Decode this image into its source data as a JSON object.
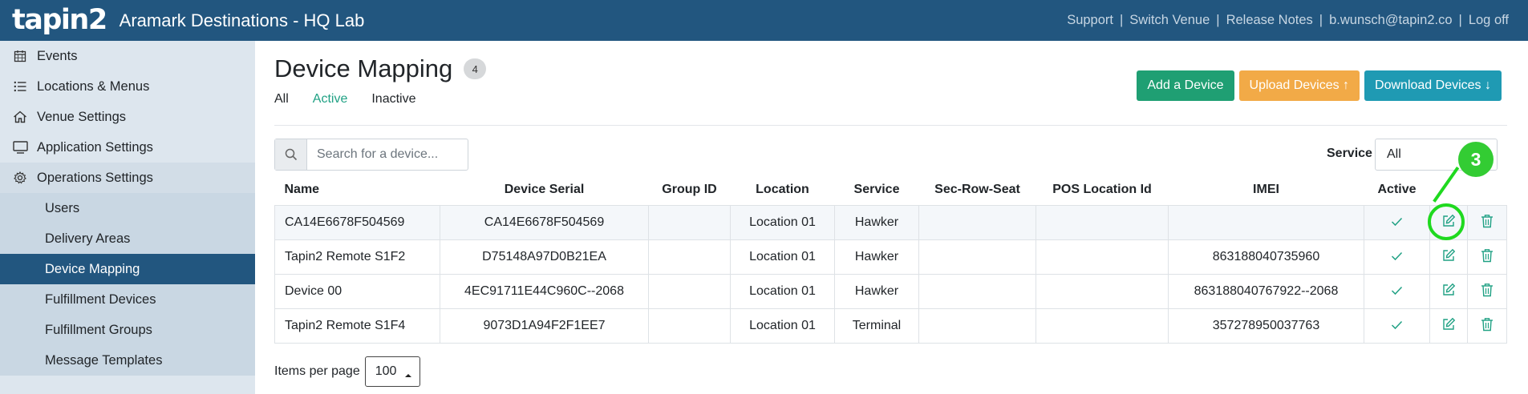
{
  "header": {
    "logo": "tapin2",
    "venue": "Aramark Destinations - HQ Lab",
    "links": [
      "Support",
      "Switch Venue",
      "Release Notes",
      "b.wunsch@tapin2.co",
      "Log off"
    ]
  },
  "sidebar": {
    "items": [
      {
        "label": "Events",
        "icon": "calendar-icon"
      },
      {
        "label": "Locations & Menus",
        "icon": "list-icon"
      },
      {
        "label": "Venue Settings",
        "icon": "home-icon"
      },
      {
        "label": "Application Settings",
        "icon": "monitor-icon"
      },
      {
        "label": "Operations Settings",
        "icon": "gear-icon"
      }
    ],
    "subitems": [
      "Users",
      "Delivery Areas",
      "Device Mapping",
      "Fulfillment Devices",
      "Fulfillment Groups",
      "Message Templates"
    ]
  },
  "page": {
    "title": "Device Mapping",
    "count": "4",
    "filters": [
      "All",
      "Active",
      "Inactive"
    ],
    "buttons": {
      "add": "Add a Device",
      "upload": "Upload Devices ↑",
      "download": "Download Devices ↓"
    },
    "search_placeholder": "Search for a device...",
    "service_label": "Service",
    "service_value": "All",
    "items_per_page_label": "Items per page",
    "items_per_page_value": "100"
  },
  "table": {
    "headers": [
      "Name",
      "Device Serial",
      "Group ID",
      "Location",
      "Service",
      "Sec-Row-Seat",
      "POS Location Id",
      "IMEI",
      "Active"
    ],
    "rows": [
      {
        "name": "CA14E6678F504569",
        "serial": "CA14E6678F504569",
        "group": "",
        "location": "Location 01",
        "service": "Hawker",
        "seat": "",
        "pos": "",
        "imei": ""
      },
      {
        "name": "Tapin2 Remote S1F2",
        "serial": "D75148A97D0B21EA",
        "group": "",
        "location": "Location 01",
        "service": "Hawker",
        "seat": "",
        "pos": "",
        "imei": "863188040735960"
      },
      {
        "name": "Device 00",
        "serial": "4EC91711E44C960C--2068",
        "group": "",
        "location": "Location 01",
        "service": "Hawker",
        "seat": "",
        "pos": "",
        "imei": "863188040767922--2068"
      },
      {
        "name": "Tapin2 Remote S1F4",
        "serial": "9073D1A94F2F1EE7",
        "group": "",
        "location": "Location 01",
        "service": "Terminal",
        "seat": "",
        "pos": "",
        "imei": "357278950037763"
      }
    ]
  },
  "annotation": {
    "number": "3"
  },
  "colors": {
    "header": "#22567f",
    "active_filter": "#20a184",
    "check": "#20a184",
    "marker": "#1fd91f"
  }
}
